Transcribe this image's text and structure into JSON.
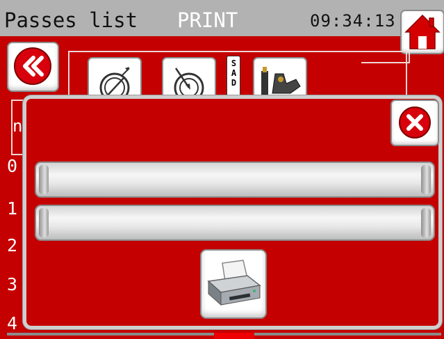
{
  "titlebar": {
    "title": "Passes list",
    "mode": "PRINT",
    "time": "09:34:13"
  },
  "icons": {
    "home": "home-icon",
    "back": "double-chevron-left-icon",
    "tool_1": "cable-spool-icon",
    "tool_2": "cable-spool-arrow-icon",
    "tool_3": "clamp-tool-icon",
    "close": "close-icon",
    "print": "printer-icon"
  },
  "background": {
    "sad_label": "SAD",
    "side_letter": "n",
    "row_numbers": [
      "0",
      "1",
      "2",
      "3",
      "4"
    ]
  },
  "dialog": {
    "field_1_value": "",
    "field_2_value": ""
  },
  "colors": {
    "background_red": "#c40000",
    "titlebar_gray": "#b2b2b2",
    "home_red": "#d40000",
    "close_red": "#d8000c"
  }
}
